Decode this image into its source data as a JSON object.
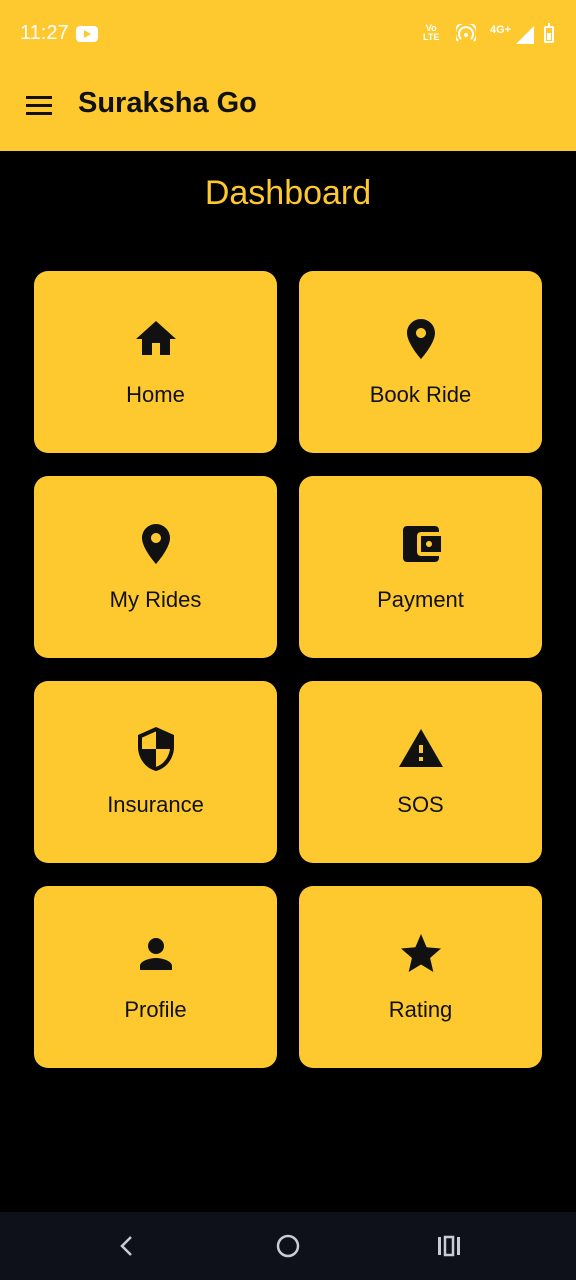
{
  "status_bar": {
    "time": "11:27",
    "volte_top": "Vo",
    "volte_bottom": "LTE",
    "network": "4G+"
  },
  "app_bar": {
    "title": "Suraksha Go"
  },
  "page": {
    "title": "Dashboard"
  },
  "tiles": [
    {
      "label": "Home",
      "icon": "home-icon"
    },
    {
      "label": "Book Ride",
      "icon": "location-pin-icon"
    },
    {
      "label": "My Rides",
      "icon": "location-pin-icon"
    },
    {
      "label": "Payment",
      "icon": "wallet-icon"
    },
    {
      "label": "Insurance",
      "icon": "shield-icon"
    },
    {
      "label": "SOS",
      "icon": "warning-icon"
    },
    {
      "label": "Profile",
      "icon": "person-icon"
    },
    {
      "label": "Rating",
      "icon": "star-icon"
    }
  ],
  "colors": {
    "accent": "#FDC92F",
    "background": "#000000",
    "text_dark": "#111111",
    "nav_bar": "#0f111a"
  }
}
